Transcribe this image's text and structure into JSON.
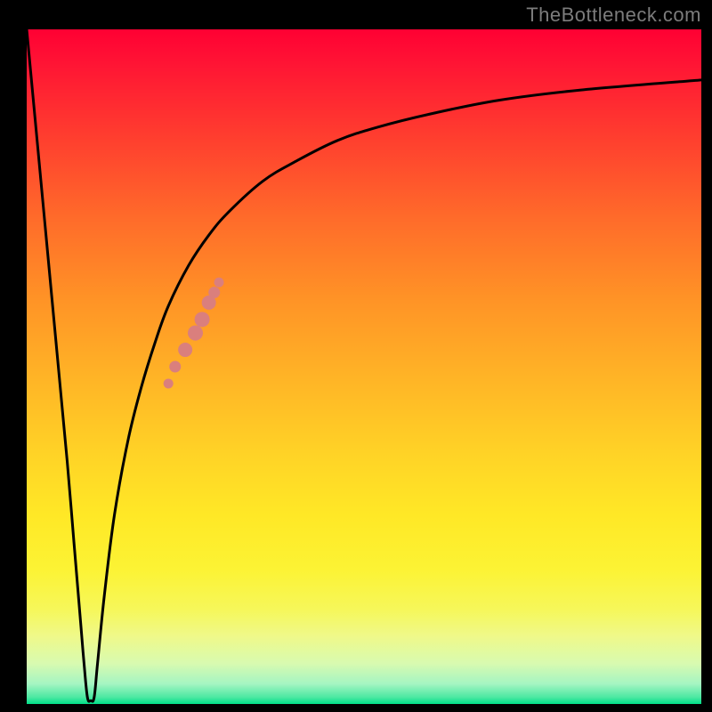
{
  "attribution": "TheBottleneck.com",
  "chart_data": {
    "type": "line",
    "title": "",
    "xlabel": "",
    "ylabel": "",
    "xlim": [
      0,
      100
    ],
    "ylim": [
      0,
      100
    ],
    "series": [
      {
        "name": "bottleneck-curve",
        "x": [
          0.0,
          1.5,
          3.0,
          4.5,
          6.0,
          7.0,
          8.0,
          8.5,
          9.0,
          9.5,
          10.0,
          10.5,
          11.5,
          13.0,
          15.0,
          17.0,
          19.0,
          21.0,
          24.0,
          27.0,
          30.0,
          35.0,
          40.0,
          46.0,
          52.0,
          60.0,
          70.0,
          82.0,
          100.0
        ],
        "values": [
          100.0,
          84.0,
          68.0,
          52.0,
          36.0,
          24.0,
          12.0,
          6.0,
          1.0,
          0.5,
          1.0,
          6.0,
          16.0,
          28.0,
          39.0,
          47.0,
          53.5,
          59.0,
          65.0,
          69.5,
          73.0,
          77.5,
          80.5,
          83.5,
          85.5,
          87.5,
          89.5,
          91.0,
          92.5
        ]
      }
    ],
    "highlight": {
      "name": "highlight-segment",
      "x": [
        21.0,
        22.0,
        23.5,
        25.0,
        26.0,
        27.0,
        27.8,
        28.5
      ],
      "values": [
        47.5,
        50.0,
        52.5,
        55.0,
        57.0,
        59.5,
        61.0,
        62.5
      ]
    },
    "colors": {
      "curve": "#000000",
      "highlight": "#da7f7d",
      "gradient_top": "#ff0033",
      "gradient_bottom": "#00df88"
    }
  }
}
